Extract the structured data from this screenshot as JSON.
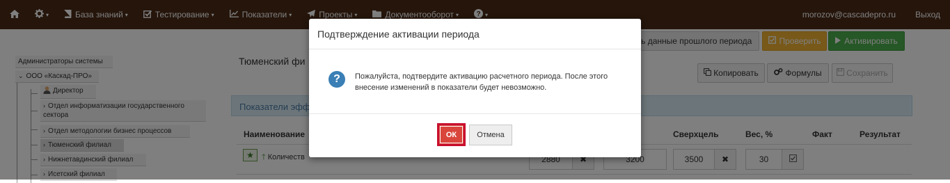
{
  "navbar": {
    "items": [
      {
        "icon": "home-icon",
        "label": ""
      },
      {
        "icon": "gear-icon",
        "label": ""
      },
      {
        "icon": "book-icon",
        "label": "База знаний"
      },
      {
        "icon": "checkbox-icon",
        "label": "Тестирование"
      },
      {
        "icon": "chart-line-icon",
        "label": "Показатели"
      },
      {
        "icon": "paper-plane-icon",
        "label": "Проекты"
      },
      {
        "icon": "folder-icon",
        "label": "Документооборот"
      },
      {
        "icon": "help-circle-icon",
        "label": ""
      }
    ],
    "user_email": "morozov@cascadepro.ru",
    "logout_label": "Выход"
  },
  "toolbar": {
    "prev_period_label": "ть данные прошлого периода",
    "check_label": "Проверить",
    "activate_label": "Активировать"
  },
  "tree": {
    "admins": "Администраторы системы",
    "org": "ООО «Каскад-ПРО»",
    "director": "Директор",
    "dept_info_line1": "Отдел информатизации государственного",
    "dept_info_line2": "сектора",
    "dept_method": "Отдел методологии бизнес процессов",
    "tyumen": "Тюменский филиал",
    "nizhnetavda": "Нижнетавдинский филиал",
    "iset": "Исетский филиал"
  },
  "main": {
    "title": "Тюменский фи",
    "copy_label": "Копировать",
    "formulas_label": "Формулы",
    "save_label": "Сохранить",
    "panel_title": "Показатели эфф",
    "columns": {
      "name": "Наименование",
      "overgoal": "Сверхцель",
      "weight": "Вес, %",
      "fact": "Факт",
      "result": "Результат"
    },
    "row": {
      "label": "Количеств",
      "value1": "2880",
      "value2": "3200",
      "value3": "3500",
      "weight": "30"
    }
  },
  "modal": {
    "title": "Подтверждение активации периода",
    "message": "Пожалуйста, подтвердите активацию расчетного периода. После этого внесение изменений в показатели будет невозможно.",
    "ok_label": "ОК",
    "cancel_label": "Отмена"
  },
  "colors": {
    "navbar": "#4a2a16",
    "check": "#f0b232",
    "activate": "#4cae4c",
    "ok": "#d9453b",
    "highlight": "#c8102e",
    "question_icon": "#3a7fb5"
  }
}
